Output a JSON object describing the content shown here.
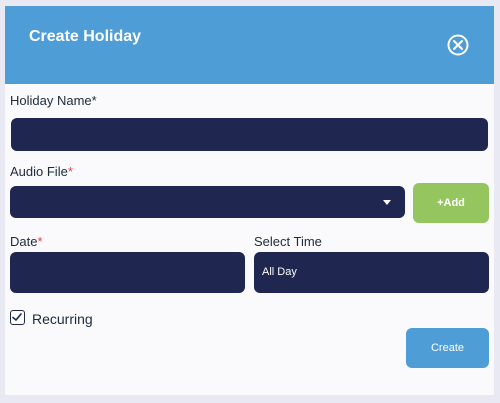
{
  "dialog": {
    "title": "Create Holiday",
    "close_icon": "close-circle-icon"
  },
  "form": {
    "holiday_name": {
      "label": "Holiday Name*",
      "value": ""
    },
    "audio_file": {
      "label": "Audio File",
      "required_mark": "*",
      "value": "",
      "dropdown_icon": "caret-down-icon"
    },
    "add_button_label": "+Add",
    "date": {
      "label": "Date",
      "required_mark": "*",
      "value": ""
    },
    "select_time": {
      "label": "Select Time",
      "value": "All Day"
    },
    "recurring": {
      "label": "Recurring",
      "checked": true,
      "icon": "checkmark-icon"
    },
    "create_button_label": "Create"
  },
  "colors": {
    "header": "#4f9dd6",
    "field_bg": "#1f2750",
    "add_button": "#95c55f",
    "create_button": "#4f9dd6",
    "required": "#e2454a"
  }
}
